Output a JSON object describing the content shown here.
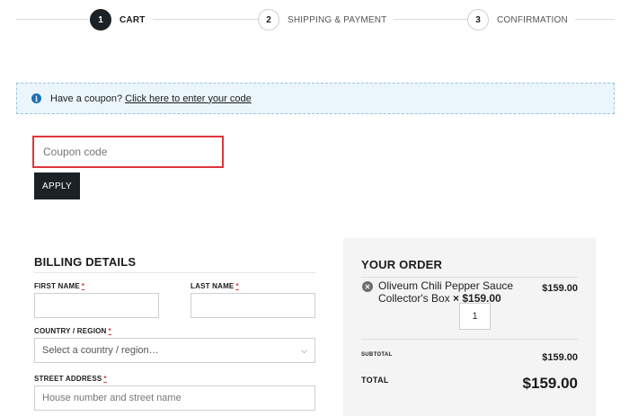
{
  "steps": [
    {
      "num": "1",
      "label": "CART"
    },
    {
      "num": "2",
      "label": "SHIPPING & PAYMENT"
    },
    {
      "num": "3",
      "label": "CONFIRMATION"
    }
  ],
  "coupon": {
    "notice_text": "Have a coupon?",
    "notice_link": "Click here to enter your code",
    "info_icon": "i",
    "placeholder": "Coupon code",
    "apply_label": "APPLY"
  },
  "billing": {
    "title": "BILLING DETAILS",
    "first_name_label": "FIRST NAME",
    "last_name_label": "LAST NAME",
    "country_label": "COUNTRY / REGION",
    "country_placeholder": "Select a country / region…",
    "street_label": "STREET ADDRESS",
    "street_placeholder": "House number and street name",
    "required_mark": "*"
  },
  "order": {
    "title": "YOUR ORDER",
    "item_name": "Oliveum Chili Pepper Sauce Collector's Box",
    "item_qty_price": "× $159.00",
    "item_total": "$159.00",
    "quantity": "1",
    "subtotal_label": "SUBTOTAL",
    "subtotal_value": "$159.00",
    "total_label": "TOTAL",
    "total_value": "$159.00"
  },
  "colors": {
    "accent_dark": "#1c2126",
    "required_red": "#e0353b",
    "notice_bg": "#eaf6fc",
    "info_blue": "#1e6fb7"
  }
}
